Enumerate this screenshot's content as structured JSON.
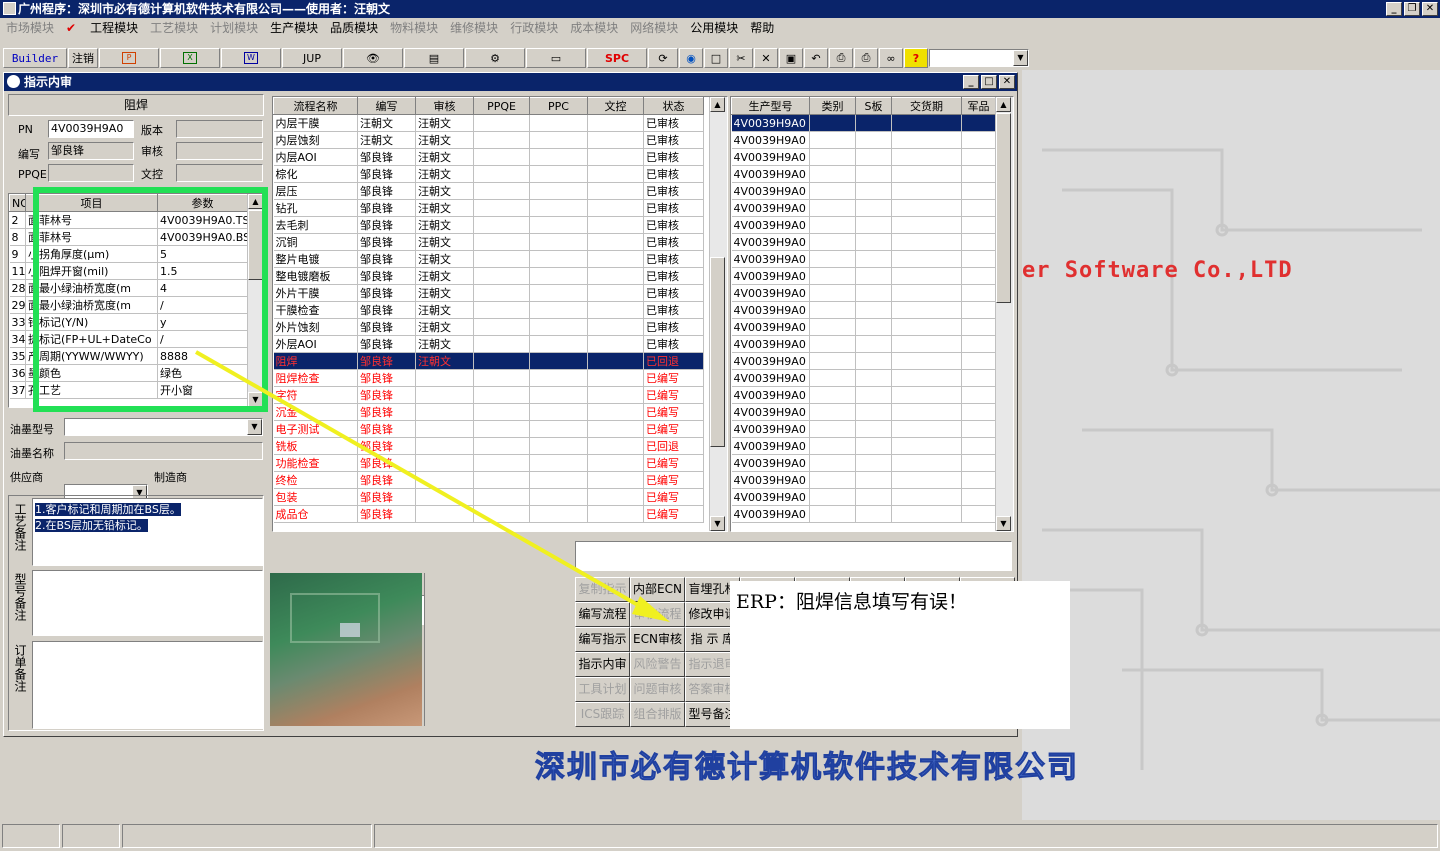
{
  "app": {
    "title": "广州程序：深圳市必有德计算机软件技术有限公司——使用者：汪朝文"
  },
  "menu": [
    {
      "label": "市场模块",
      "disabled": true
    },
    {
      "label": "工程模块",
      "disabled": false,
      "checked": true
    },
    {
      "label": "工艺模块",
      "disabled": true
    },
    {
      "label": "计划模块",
      "disabled": true
    },
    {
      "label": "生产模块",
      "disabled": false
    },
    {
      "label": "品质模块",
      "disabled": false
    },
    {
      "label": "物料模块",
      "disabled": true
    },
    {
      "label": "维修模块",
      "disabled": true
    },
    {
      "label": "行政模块",
      "disabled": true
    },
    {
      "label": "成本模块",
      "disabled": true
    },
    {
      "label": "网络模块",
      "disabled": true
    },
    {
      "label": "公用模块",
      "disabled": false
    },
    {
      "label": "帮助",
      "disabled": false
    }
  ],
  "toolbar": {
    "builder_label": "Builder",
    "logout_label": "注销",
    "jup_label": "JUP",
    "spc_label": "SPC",
    "help_glyph": "?"
  },
  "child_window": {
    "title": "指示内审"
  },
  "left_panel": {
    "section_title": "阻焊",
    "pn_label": "PN",
    "pn_value": "4V0039H9A0",
    "version_label": "版本",
    "author_label": "编写",
    "author_value": "邹良锋",
    "review_label": "审核",
    "ppqe_label": "PPQE",
    "doc_control_label": "文控",
    "param_headers": [
      "NO",
      "项目",
      "参数"
    ],
    "params": [
      {
        "no": "2",
        "item": "面菲林号",
        "value": "4V0039H9A0.TS"
      },
      {
        "no": "8",
        "item": "面菲林号",
        "value": "4V0039H9A0.BS"
      },
      {
        "no": "9",
        "item": "小拐角厚度(μm)",
        "value": "5"
      },
      {
        "no": "11",
        "item": "小阻焊开窗(mil)",
        "value": "1.5"
      },
      {
        "no": "28",
        "item": "面最小绿油桥宽度(m",
        "value": "4"
      },
      {
        "no": "29",
        "item": "面最小绿油桥宽度(m",
        "value": "/"
      },
      {
        "no": "33",
        "item": "铅标记(Y/N)",
        "value": "y"
      },
      {
        "no": "34",
        "item": "捷标记(FP+UL+DateCo",
        "value": "/"
      },
      {
        "no": "35",
        "item": "产周期(YYWW/WWYY)",
        "value": "8888"
      },
      {
        "no": "36",
        "item": "墨颜色",
        "value": "绿色"
      },
      {
        "no": "37",
        "item": "孔工艺",
        "value": "开小窗"
      }
    ],
    "ink_model_label": "油墨型号",
    "ink_name_label": "油墨名称",
    "supplier_label": "供应商",
    "manufacturer_label": "制造商",
    "process_notes_label": "工艺备注",
    "process_notes": [
      "1.客户标记和周期加在BS层。",
      "2.在BS层加无铅标记。"
    ],
    "model_notes_label": "型号备注",
    "order_notes_label": "订单备注"
  },
  "flow_grid": {
    "headers": [
      "流程名称",
      "编写",
      "审核",
      "PPQE",
      "PPC",
      "文控",
      "状态"
    ],
    "rows": [
      {
        "name": "内层干膜",
        "author": "汪朝文",
        "reviewer": "汪朝文",
        "ppqe": "",
        "ppc": "",
        "doc": "",
        "status": "已审核",
        "style": "normal"
      },
      {
        "name": "内层蚀刻",
        "author": "汪朝文",
        "reviewer": "汪朝文",
        "ppqe": "",
        "ppc": "",
        "doc": "",
        "status": "已审核",
        "style": "normal"
      },
      {
        "name": "内层AOI",
        "author": "邹良锋",
        "reviewer": "汪朝文",
        "ppqe": "",
        "ppc": "",
        "doc": "",
        "status": "已审核",
        "style": "normal"
      },
      {
        "name": "棕化",
        "author": "邹良锋",
        "reviewer": "汪朝文",
        "ppqe": "",
        "ppc": "",
        "doc": "",
        "status": "已审核",
        "style": "normal"
      },
      {
        "name": "层压",
        "author": "邹良锋",
        "reviewer": "汪朝文",
        "ppqe": "",
        "ppc": "",
        "doc": "",
        "status": "已审核",
        "style": "normal"
      },
      {
        "name": "钻孔",
        "author": "邹良锋",
        "reviewer": "汪朝文",
        "ppqe": "",
        "ppc": "",
        "doc": "",
        "status": "已审核",
        "style": "normal"
      },
      {
        "name": "去毛刺",
        "author": "邹良锋",
        "reviewer": "汪朝文",
        "ppqe": "",
        "ppc": "",
        "doc": "",
        "status": "已审核",
        "style": "normal"
      },
      {
        "name": "沉铜",
        "author": "邹良锋",
        "reviewer": "汪朝文",
        "ppqe": "",
        "ppc": "",
        "doc": "",
        "status": "已审核",
        "style": "normal"
      },
      {
        "name": "整片电镀",
        "author": "邹良锋",
        "reviewer": "汪朝文",
        "ppqe": "",
        "ppc": "",
        "doc": "",
        "status": "已审核",
        "style": "normal"
      },
      {
        "name": "整电镀磨板",
        "author": "邹良锋",
        "reviewer": "汪朝文",
        "ppqe": "",
        "ppc": "",
        "doc": "",
        "status": "已审核",
        "style": "normal"
      },
      {
        "name": "外片干膜",
        "author": "邹良锋",
        "reviewer": "汪朝文",
        "ppqe": "",
        "ppc": "",
        "doc": "",
        "status": "已审核",
        "style": "normal"
      },
      {
        "name": "干膜检查",
        "author": "邹良锋",
        "reviewer": "汪朝文",
        "ppqe": "",
        "ppc": "",
        "doc": "",
        "status": "已审核",
        "style": "normal"
      },
      {
        "name": "外片蚀刻",
        "author": "邹良锋",
        "reviewer": "汪朝文",
        "ppqe": "",
        "ppc": "",
        "doc": "",
        "status": "已审核",
        "style": "normal"
      },
      {
        "name": "外层AOI",
        "author": "邹良锋",
        "reviewer": "汪朝文",
        "ppqe": "",
        "ppc": "",
        "doc": "",
        "status": "已审核",
        "style": "normal"
      },
      {
        "name": "阻焊",
        "author": "邹良锋",
        "reviewer": "汪朝文",
        "ppqe": "",
        "ppc": "",
        "doc": "",
        "status": "已回退",
        "style": "selred"
      },
      {
        "name": "阻焊检查",
        "author": "邹良锋",
        "reviewer": "",
        "ppqe": "",
        "ppc": "",
        "doc": "",
        "status": "已编写",
        "style": "red"
      },
      {
        "name": "字符",
        "author": "邹良锋",
        "reviewer": "",
        "ppqe": "",
        "ppc": "",
        "doc": "",
        "status": "已编写",
        "style": "red"
      },
      {
        "name": "沉金",
        "author": "邹良锋",
        "reviewer": "",
        "ppqe": "",
        "ppc": "",
        "doc": "",
        "status": "已编写",
        "style": "red"
      },
      {
        "name": "电子测试",
        "author": "邹良锋",
        "reviewer": "",
        "ppqe": "",
        "ppc": "",
        "doc": "",
        "status": "已编写",
        "style": "red"
      },
      {
        "name": "铣板",
        "author": "邹良锋",
        "reviewer": "",
        "ppqe": "",
        "ppc": "",
        "doc": "",
        "status": "已回退",
        "style": "red"
      },
      {
        "name": "功能检查",
        "author": "邹良锋",
        "reviewer": "",
        "ppqe": "",
        "ppc": "",
        "doc": "",
        "status": "已编写",
        "style": "red"
      },
      {
        "name": "终检",
        "author": "邹良锋",
        "reviewer": "",
        "ppqe": "",
        "ppc": "",
        "doc": "",
        "status": "已编写",
        "style": "red"
      },
      {
        "name": "包装",
        "author": "邹良锋",
        "reviewer": "",
        "ppqe": "",
        "ppc": "",
        "doc": "",
        "status": "已编写",
        "style": "red"
      },
      {
        "name": "成品仓",
        "author": "邹良锋",
        "reviewer": "",
        "ppqe": "",
        "ppc": "",
        "doc": "",
        "status": "已编写",
        "style": "red"
      }
    ]
  },
  "model_grid": {
    "headers": [
      "生产型号",
      "类别",
      "S板",
      "交货期",
      "军品"
    ],
    "rows": [
      "4V0039H9A0",
      "4V0039H9A0",
      "4V0039H9A0",
      "4V0039H9A0",
      "4V0039H9A0",
      "4V0039H9A0",
      "4V0039H9A0",
      "4V0039H9A0",
      "4V0039H9A0",
      "4V0039H9A0",
      "4V0039H9A0",
      "4V0039H9A0",
      "4V0039H9A0",
      "4V0039H9A0",
      "4V0039H9A0",
      "4V0039H9A0",
      "4V0039H9A0",
      "4V0039H9A0",
      "4V0039H9A0",
      "4V0039H9A0",
      "4V0039H9A0",
      "4V0039H9A0",
      "4V0039H9A0",
      "4V0039H9A0"
    ]
  },
  "action_buttons": [
    {
      "label": "复制指示",
      "disabled": true
    },
    {
      "label": "内部ECN",
      "disabled": false
    },
    {
      "label": "盲埋孔材",
      "disabled": false
    },
    {
      "label": "编写流程",
      "disabled": false
    },
    {
      "label": "审核流程",
      "disabled": true
    },
    {
      "label": "修改申请",
      "disabled": false
    },
    {
      "label": "编写指示",
      "disabled": false
    },
    {
      "label": "ECN审核",
      "disabled": false
    },
    {
      "label": "指 示 库",
      "disabled": false
    },
    {
      "label": "指示内审",
      "disabled": false
    },
    {
      "label": "风险警告",
      "disabled": true
    },
    {
      "label": "指示退审",
      "disabled": true
    },
    {
      "label": "工具计划",
      "disabled": true
    },
    {
      "label": "问题审核",
      "disabled": true
    },
    {
      "label": "答案审核",
      "disabled": true
    },
    {
      "label": "ICS跟踪",
      "disabled": true
    },
    {
      "label": "组合排版",
      "disabled": true
    },
    {
      "label": "型号备注",
      "disabled": false
    }
  ],
  "desktop": {
    "software_text": "er Software Co.,LTD",
    "company_text": "深圳市必有德计算机软件技术有限公司"
  },
  "annotation": {
    "text": "ERP：阻焊信息填写有误！",
    "highlight_color": "#22e055",
    "arrow_color": "#f0f020"
  }
}
